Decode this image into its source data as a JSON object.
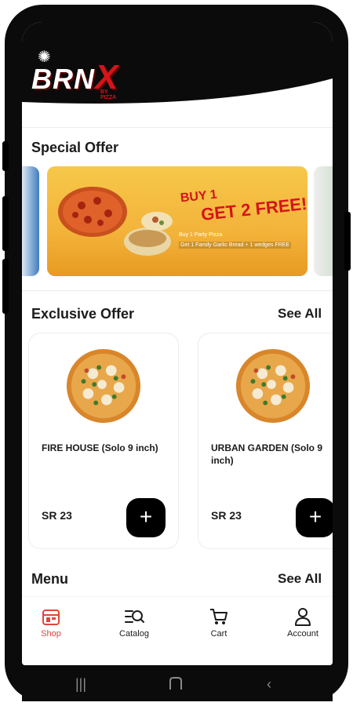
{
  "brand": {
    "logo_text": "BRN",
    "logo_x": "X",
    "logo_sub": "BY PIZZA"
  },
  "special_offer": {
    "title": "Special Offer",
    "promo_line1": "BUY 1",
    "promo_line2": "GET 2 FREE!",
    "promo_sub1": "Buy 1 Party Pizza",
    "promo_sub2": "Get 1 Family Garlic Bread + 1 wedges FREE"
  },
  "exclusive_offer": {
    "title": "Exclusive Offer",
    "see_all": "See All",
    "products": [
      {
        "name": "FIRE HOUSE (Solo 9 inch)",
        "price": "SR 23"
      },
      {
        "name": "URBAN GARDEN (Solo 9 inch)",
        "price": "SR 23"
      }
    ],
    "add_icon": "plus-icon"
  },
  "menu_section": {
    "title": "Menu",
    "see_all": "See All"
  },
  "nav": {
    "items": [
      {
        "label": "Shop",
        "icon": "shop-icon",
        "active": true
      },
      {
        "label": "Catalog",
        "icon": "catalog-icon",
        "active": false
      },
      {
        "label": "Cart",
        "icon": "cart-icon",
        "active": false
      },
      {
        "label": "Account",
        "icon": "account-icon",
        "active": false
      }
    ]
  },
  "colors": {
    "accent": "#e0443c",
    "header": "#0b0b0b",
    "banner": "#f3b33a",
    "promo_red": "#d4141b"
  }
}
